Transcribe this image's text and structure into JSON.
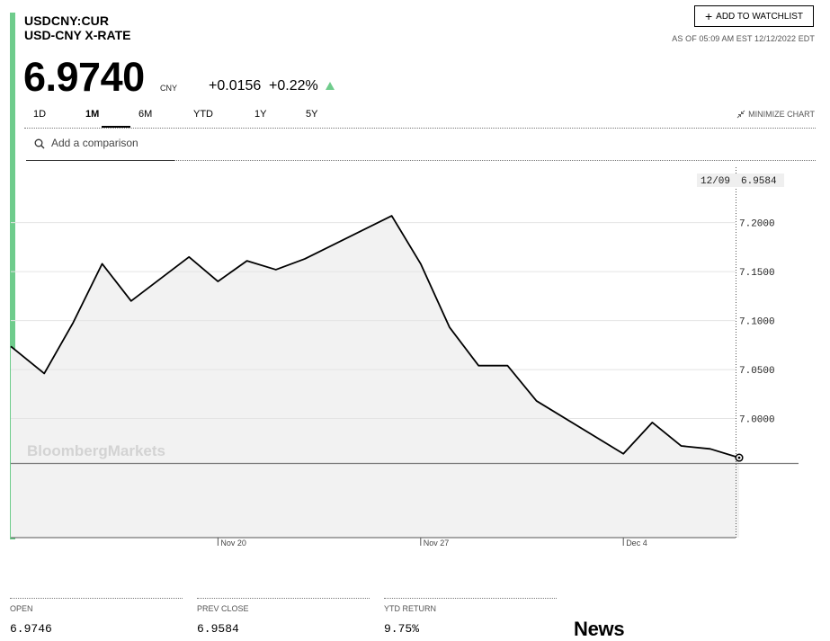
{
  "header": {
    "ticker": "USDCNY:CUR",
    "name": "USD-CNY X-RATE",
    "watchlist_label": "ADD TO WATCHLIST",
    "as_of": "AS OF 05:09 AM EST 12/12/2022 EDT"
  },
  "quote": {
    "price": "6.9740",
    "currency": "CNY",
    "change": "+0.0156",
    "change_pct": "+0.22%",
    "direction": "up",
    "up_color": "#6fcc8c"
  },
  "tabs": [
    {
      "label": "1D",
      "active": false
    },
    {
      "label": "1M",
      "active": true
    },
    {
      "label": "6M",
      "active": false
    },
    {
      "label": "YTD",
      "active": false
    },
    {
      "label": "1Y",
      "active": false
    },
    {
      "label": "5Y",
      "active": false
    }
  ],
  "minimize_label": "MINIMIZE CHART",
  "comparison": {
    "placeholder": "Add a comparison"
  },
  "chart_data": {
    "type": "area",
    "watermark": "BloombergMarkets",
    "yticks": [
      7.2,
      7.15,
      7.1,
      7.05,
      7.0
    ],
    "ytick_labels": [
      "7.2000",
      "7.1500",
      "7.1000",
      "7.0500",
      "7.0000"
    ],
    "ylim": [
      6.8784,
      7.2566
    ],
    "xticks": [
      {
        "label": "Nov 20",
        "day": 20
      },
      {
        "label": "Nov 27",
        "day": 27
      },
      {
        "label": "Dec 4",
        "day": 34
      }
    ],
    "xlim": [
      12.8,
      40.1
    ],
    "baseline": 6.9584,
    "line_color": "#000000",
    "fill_color": "#f2f2f2",
    "grid": true,
    "x": [
      13,
      14,
      15,
      16,
      17,
      19,
      20,
      21,
      22,
      23,
      26,
      27,
      28,
      29,
      30,
      31,
      34,
      35,
      36,
      37,
      38
    ],
    "y": [
      7.07,
      7.046,
      7.098,
      7.158,
      7.12,
      7.165,
      7.14,
      7.161,
      7.152,
      7.163,
      7.207,
      7.158,
      7.093,
      7.054,
      7.054,
      7.018,
      6.964,
      6.996,
      6.972,
      6.969,
      6.96
    ],
    "crosshair": {
      "date": "12/09",
      "value": "6.9584"
    }
  },
  "stats": [
    {
      "label": "OPEN",
      "value": "6.9746"
    },
    {
      "label": "PREV CLOSE",
      "value": "6.9584"
    },
    {
      "label": "YTD RETURN",
      "value": "9.75%"
    }
  ],
  "news_title": "News"
}
